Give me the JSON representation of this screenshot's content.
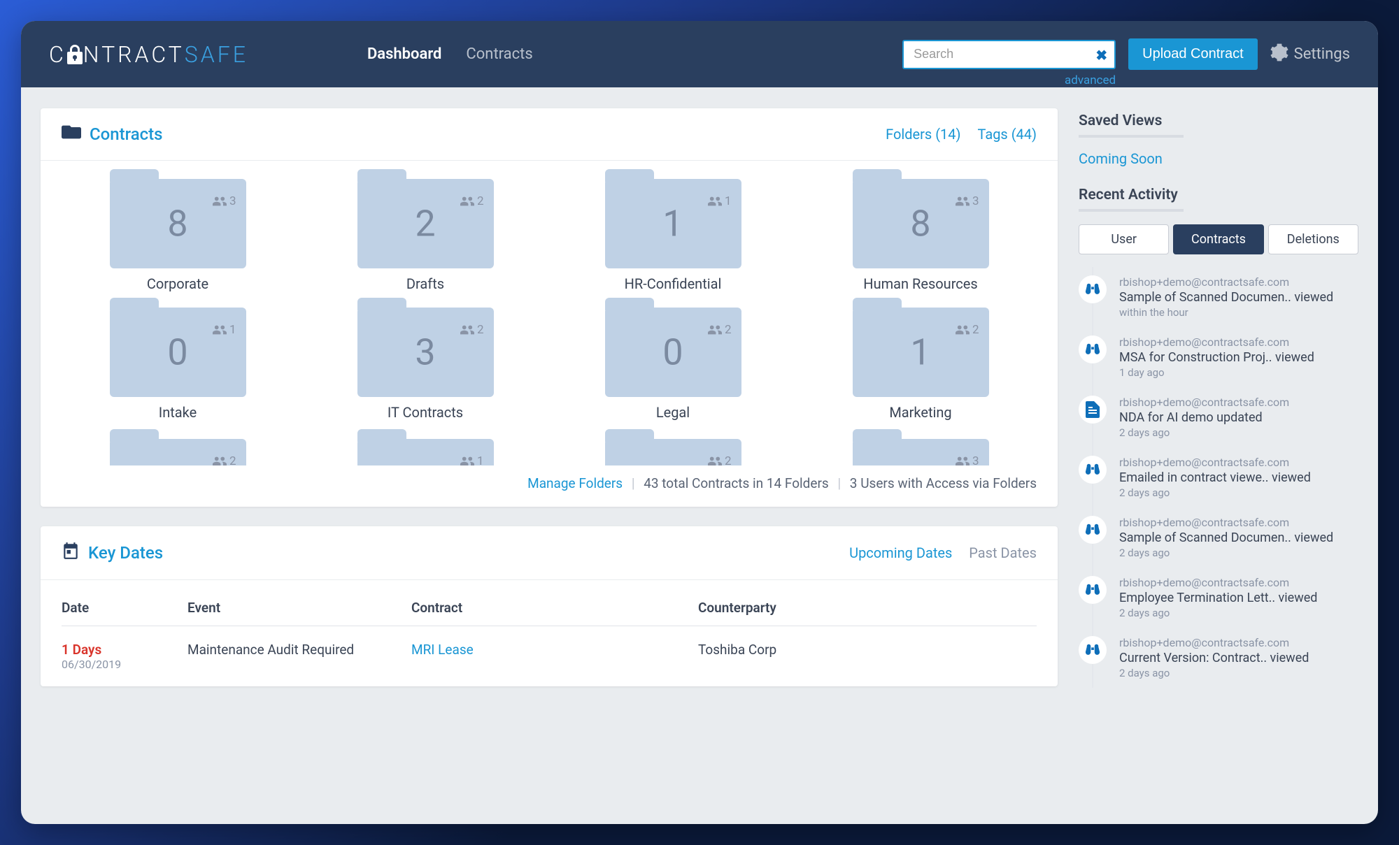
{
  "brand": {
    "left": "C",
    "mid": "NTRACT",
    "right": "SAFE"
  },
  "nav": {
    "dashboard": "Dashboard",
    "contracts": "Contracts"
  },
  "search": {
    "placeholder": "Search",
    "advanced": "advanced"
  },
  "header": {
    "upload": "Upload Contract",
    "settings": "Settings"
  },
  "contracts_card": {
    "title": "Contracts",
    "folders_link": "Folders (14)",
    "tags_link": "Tags (44)",
    "manage": "Manage Folders",
    "summary1": "43 total Contracts in 14 Folders",
    "summary2": "3 Users with Access via Folders"
  },
  "folders": [
    {
      "name": "Corporate",
      "count": "8",
      "users": "3"
    },
    {
      "name": "Drafts",
      "count": "2",
      "users": "2"
    },
    {
      "name": "HR-Confidential",
      "count": "1",
      "users": "1"
    },
    {
      "name": "Human Resources",
      "count": "8",
      "users": "3"
    },
    {
      "name": "Intake",
      "count": "0",
      "users": "1"
    },
    {
      "name": "IT Contracts",
      "count": "3",
      "users": "2"
    },
    {
      "name": "Legal",
      "count": "0",
      "users": "2"
    },
    {
      "name": "Marketing",
      "count": "1",
      "users": "2"
    }
  ],
  "folders_partial": [
    {
      "users": "2"
    },
    {
      "users": "1"
    },
    {
      "users": "2"
    },
    {
      "users": "3"
    }
  ],
  "keydates": {
    "title": "Key Dates",
    "upcoming": "Upcoming Dates",
    "past": "Past Dates",
    "cols": {
      "date": "Date",
      "event": "Event",
      "contract": "Contract",
      "counterparty": "Counterparty"
    },
    "rows": [
      {
        "days": "1 Days",
        "date": "06/30/2019",
        "event": "Maintenance Audit Required",
        "contract": "MRI Lease",
        "counterparty": "Toshiba Corp"
      }
    ]
  },
  "sidebar": {
    "saved_views": "Saved Views",
    "coming_soon": "Coming Soon",
    "recent_activity": "Recent Activity",
    "tabs": {
      "user": "User",
      "contracts": "Contracts",
      "deletions": "Deletions"
    }
  },
  "activity": [
    {
      "user": "rbishop+demo@contractsafe.com",
      "msg": "Sample of Scanned Documen.. viewed",
      "time": "within the hour",
      "icon": "binoculars"
    },
    {
      "user": "rbishop+demo@contractsafe.com",
      "msg": "MSA for Construction Proj.. viewed",
      "time": "1 day ago",
      "icon": "binoculars"
    },
    {
      "user": "rbishop+demo@contractsafe.com",
      "msg": "NDA for AI demo updated",
      "time": "2 days ago",
      "icon": "doc"
    },
    {
      "user": "rbishop+demo@contractsafe.com",
      "msg": "Emailed in contract viewe.. viewed",
      "time": "2 days ago",
      "icon": "binoculars"
    },
    {
      "user": "rbishop+demo@contractsafe.com",
      "msg": "Sample of Scanned Documen.. viewed",
      "time": "2 days ago",
      "icon": "binoculars"
    },
    {
      "user": "rbishop+demo@contractsafe.com",
      "msg": "Employee Termination Lett.. viewed",
      "time": "2 days ago",
      "icon": "binoculars"
    },
    {
      "user": "rbishop+demo@contractsafe.com",
      "msg": "Current Version: Contract.. viewed",
      "time": "2 days ago",
      "icon": "binoculars"
    }
  ]
}
